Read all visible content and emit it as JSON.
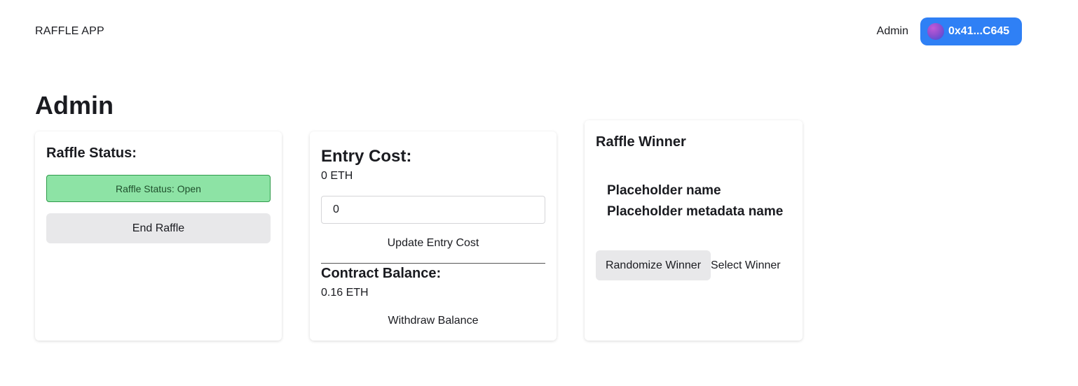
{
  "header": {
    "app_title": "RAFFLE APP",
    "admin_link": "Admin",
    "wallet": {
      "address": "0x41...C645",
      "button_color": "#2f80f5"
    }
  },
  "page": {
    "title": "Admin"
  },
  "status_card": {
    "heading": "Raffle Status:",
    "badge": "Raffle Status: Open",
    "badge_color": "#8de3a5",
    "end_button": "End Raffle"
  },
  "entry_card": {
    "entry_heading": "Entry Cost:",
    "entry_value": "0 ETH",
    "input_value": "0",
    "update_button": "Update Entry Cost",
    "balance_heading": "Contract Balance:",
    "balance_value": "0.16 ETH",
    "withdraw_button": "Withdraw Balance"
  },
  "winner_card": {
    "heading": "Raffle Winner",
    "placeholder_name": "Placeholder name",
    "placeholder_metadata": "Placeholder metadata name",
    "randomize_button": "Randomize Winner",
    "select_button": "Select Winner"
  }
}
